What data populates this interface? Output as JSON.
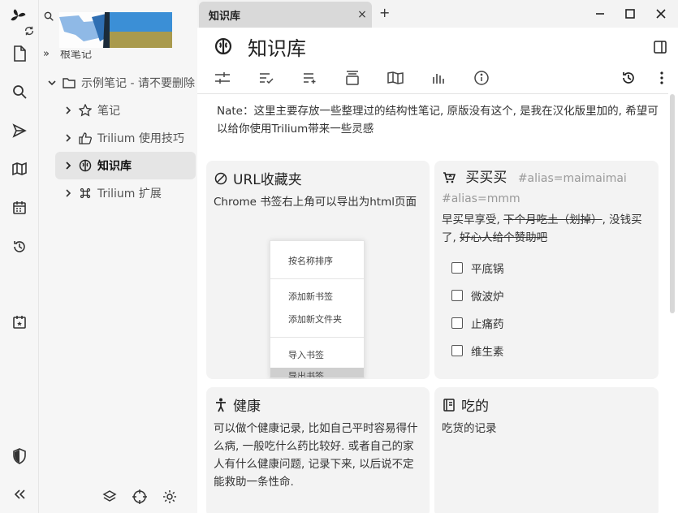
{
  "tab": {
    "title": "知识库",
    "close": "×",
    "new": "+"
  },
  "tree": {
    "root_partial": "根笔记",
    "items": [
      {
        "label": "示例笔记 - 请不要删除"
      },
      {
        "label": "笔记"
      },
      {
        "label": "Trilium 使用技巧"
      },
      {
        "label": "知识库"
      },
      {
        "label": "Trilium 扩展"
      }
    ]
  },
  "note": {
    "title": "知识库",
    "intro_prefix": "Nate",
    "intro": "：这里主要存放一些整理过的结构性笔记, 原版没有这个, 是我在汉化版里加的, 希望可以给你使用Trilium带来一些灵感"
  },
  "cards": {
    "url": {
      "title": "URL收藏夹",
      "body": "Chrome 书签右上角可以导出为html页面",
      "menu": [
        "按名称排序",
        "添加新书签",
        "添加新文件夹",
        "导入书签",
        "导出书签"
      ]
    },
    "buy": {
      "title": "买买买",
      "alias": "#alias=maimaimai #alias=mmm",
      "body_plain": "早买早享受, ",
      "body_strike": "下个月吃土（划掉）",
      "body_plain2": ", 没钱买了, ",
      "body_strike2": "好心人给个赞助吧",
      "todos": [
        "平底锅",
        "微波炉",
        "止痛药",
        "维生素"
      ]
    },
    "health": {
      "title": "健康",
      "body": "可以做个健康记录, 比如自己平时容易得什么病, 一般吃什么药比较好. 或者自己的家人有什么健康问题, 记录下来, 以后说不定能救助一条性命."
    },
    "food": {
      "title": "吃的",
      "body": "吃货的记录"
    }
  },
  "colors": {
    "active_row": "#e5e5e5",
    "card_bg": "#f3f3f3",
    "sidebar_bg": "#f6f6f6"
  }
}
